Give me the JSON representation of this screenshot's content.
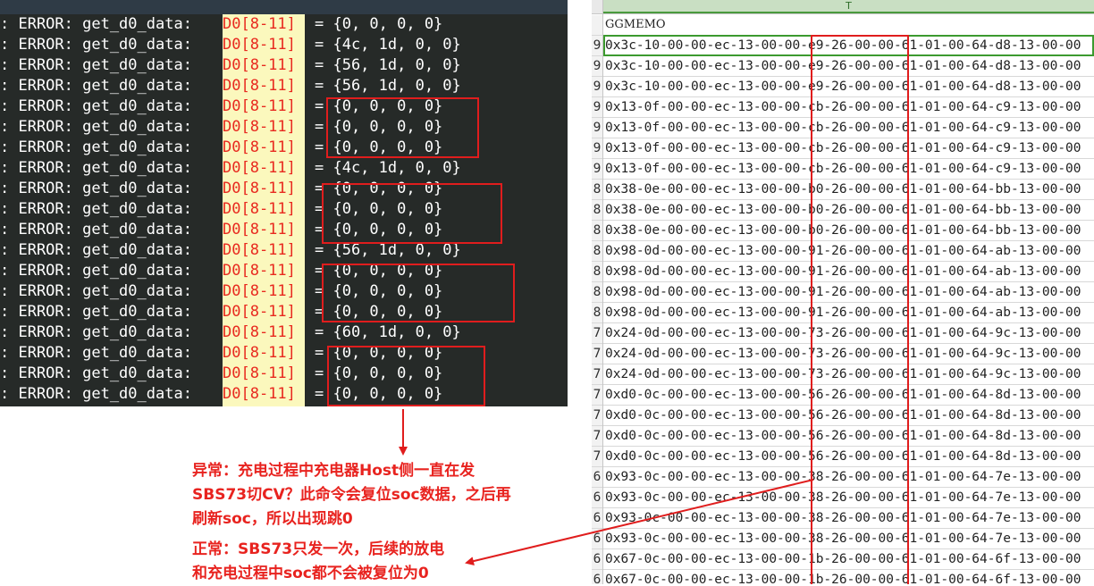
{
  "terminal": {
    "lines": [
      {
        "prefix": ": ERROR: get_d0_data:",
        "reg": "D0[8-11]",
        "value": "= {0, 0, 0, 0}"
      },
      {
        "prefix": ": ERROR: get_d0_data:",
        "reg": "D0[8-11]",
        "value": "= {4c, 1d, 0, 0}"
      },
      {
        "prefix": ": ERROR: get_d0_data:",
        "reg": "D0[8-11]",
        "value": "= {56, 1d, 0, 0}"
      },
      {
        "prefix": ": ERROR: get_d0_data:",
        "reg": "D0[8-11]",
        "value": "= {56, 1d, 0, 0}"
      },
      {
        "prefix": ": ERROR: get_d0_data:",
        "reg": "D0[8-11]",
        "value": "= {0, 0, 0, 0}"
      },
      {
        "prefix": ": ERROR: get_d0_data:",
        "reg": "D0[8-11]",
        "value": "= {0, 0, 0, 0}"
      },
      {
        "prefix": ": ERROR: get_d0_data:",
        "reg": "D0[8-11]",
        "value": "= {0, 0, 0, 0}"
      },
      {
        "prefix": ": ERROR: get_d0_data:",
        "reg": "D0[8-11]",
        "value": "= {4c, 1d, 0, 0}"
      },
      {
        "prefix": ": ERROR: get_d0_data:",
        "reg": "D0[8-11]",
        "value": "= {0, 0, 0, 0}"
      },
      {
        "prefix": ": ERROR: get_d0_data:",
        "reg": "D0[8-11]",
        "value": "= {0, 0, 0, 0}"
      },
      {
        "prefix": ": ERROR: get_d0_data:",
        "reg": "D0[8-11]",
        "value": "= {0, 0, 0, 0}"
      },
      {
        "prefix": ": ERROR: get_d0_data:",
        "reg": "D0[8-11]",
        "value": "= {56, 1d, 0, 0}"
      },
      {
        "prefix": ": ERROR: get_d0_data:",
        "reg": "D0[8-11]",
        "value": "= {0, 0, 0, 0}"
      },
      {
        "prefix": ": ERROR: get_d0_data:",
        "reg": "D0[8-11]",
        "value": "= {0, 0, 0, 0}"
      },
      {
        "prefix": ": ERROR: get_d0_data:",
        "reg": "D0[8-11]",
        "value": "= {0, 0, 0, 0}"
      },
      {
        "prefix": ": ERROR: get_d0_data:",
        "reg": "D0[8-11]",
        "value": "= {60, 1d, 0, 0}"
      },
      {
        "prefix": ": ERROR: get_d0_data:",
        "reg": "D0[8-11]",
        "value": "= {0, 0, 0, 0}"
      },
      {
        "prefix": ": ERROR: get_d0_data:",
        "reg": "D0[8-11]",
        "value": "= {0, 0, 0, 0}"
      },
      {
        "prefix": ": ERROR: get_d0_data:",
        "reg": "D0[8-11]",
        "value": "= {0, 0, 0, 0}"
      }
    ]
  },
  "sheet": {
    "column_letter": "T",
    "header": "GGMEMO",
    "rows": [
      {
        "rn": "9",
        "text": "0x3c-10-00-00-ec-13-00-00-e9-26-00-00-61-01-00-64-d8-13-00-00"
      },
      {
        "rn": "9",
        "text": "0x3c-10-00-00-ec-13-00-00-e9-26-00-00-61-01-00-64-d8-13-00-00"
      },
      {
        "rn": "9",
        "text": "0x3c-10-00-00-ec-13-00-00-e9-26-00-00-61-01-00-64-d8-13-00-00"
      },
      {
        "rn": "9",
        "text": "0x13-0f-00-00-ec-13-00-00-cb-26-00-00-61-01-00-64-c9-13-00-00"
      },
      {
        "rn": "9",
        "text": "0x13-0f-00-00-ec-13-00-00-cb-26-00-00-61-01-00-64-c9-13-00-00"
      },
      {
        "rn": "9",
        "text": "0x13-0f-00-00-ec-13-00-00-cb-26-00-00-61-01-00-64-c9-13-00-00"
      },
      {
        "rn": "9",
        "text": "0x13-0f-00-00-ec-13-00-00-cb-26-00-00-61-01-00-64-c9-13-00-00"
      },
      {
        "rn": "8",
        "text": "0x38-0e-00-00-ec-13-00-00-b0-26-00-00-61-01-00-64-bb-13-00-00"
      },
      {
        "rn": "8",
        "text": "0x38-0e-00-00-ec-13-00-00-b0-26-00-00-61-01-00-64-bb-13-00-00"
      },
      {
        "rn": "8",
        "text": "0x38-0e-00-00-ec-13-00-00-b0-26-00-00-61-01-00-64-bb-13-00-00"
      },
      {
        "rn": "8",
        "text": "0x98-0d-00-00-ec-13-00-00-91-26-00-00-61-01-00-64-ab-13-00-00"
      },
      {
        "rn": "8",
        "text": "0x98-0d-00-00-ec-13-00-00-91-26-00-00-61-01-00-64-ab-13-00-00"
      },
      {
        "rn": "8",
        "text": "0x98-0d-00-00-ec-13-00-00-91-26-00-00-61-01-00-64-ab-13-00-00"
      },
      {
        "rn": "8",
        "text": "0x98-0d-00-00-ec-13-00-00-91-26-00-00-61-01-00-64-ab-13-00-00"
      },
      {
        "rn": "7",
        "text": "0x24-0d-00-00-ec-13-00-00-73-26-00-00-61-01-00-64-9c-13-00-00"
      },
      {
        "rn": "7",
        "text": "0x24-0d-00-00-ec-13-00-00-73-26-00-00-61-01-00-64-9c-13-00-00"
      },
      {
        "rn": "7",
        "text": "0x24-0d-00-00-ec-13-00-00-73-26-00-00-61-01-00-64-9c-13-00-00"
      },
      {
        "rn": "7",
        "text": "0xd0-0c-00-00-ec-13-00-00-56-26-00-00-61-01-00-64-8d-13-00-00"
      },
      {
        "rn": "7",
        "text": "0xd0-0c-00-00-ec-13-00-00-56-26-00-00-61-01-00-64-8d-13-00-00"
      },
      {
        "rn": "7",
        "text": "0xd0-0c-00-00-ec-13-00-00-56-26-00-00-61-01-00-64-8d-13-00-00"
      },
      {
        "rn": "7",
        "text": "0xd0-0c-00-00-ec-13-00-00-56-26-00-00-61-01-00-64-8d-13-00-00"
      },
      {
        "rn": "6",
        "text": "0x93-0c-00-00-ec-13-00-00-38-26-00-00-61-01-00-64-7e-13-00-00"
      },
      {
        "rn": "6",
        "text": "0x93-0c-00-00-ec-13-00-00-38-26-00-00-61-01-00-64-7e-13-00-00"
      },
      {
        "rn": "6",
        "text": "0x93-0c-00-00-ec-13-00-00-38-26-00-00-61-01-00-64-7e-13-00-00"
      },
      {
        "rn": "6",
        "text": "0x93-0c-00-00-ec-13-00-00-38-26-00-00-61-01-00-64-7e-13-00-00"
      },
      {
        "rn": "6",
        "text": "0x67-0c-00-00-ec-13-00-00-1b-26-00-00-61-01-00-64-6f-13-00-00"
      },
      {
        "rn": "6",
        "text": "0x67-0c-00-00-ec-13-00-00-1b-26-00-00-61-01-00-64-6f-13-00-00"
      }
    ]
  },
  "notes": {
    "abnormal": {
      "line1": "异常：充电过程中充电器Host侧一直在发",
      "line2": "SBS73切CV？此命令会复位soc数据，之后再",
      "line3": "刷新soc，所以出现跳0"
    },
    "normal": {
      "line1": "正常：SBS73只发一次，后续的放电",
      "line2": "和充电过程中soc都不会被复位为0"
    }
  },
  "colors": {
    "terminal_bg": "#262a28",
    "highlight": "#fbf8bd",
    "annotation_red": "#e01d1d",
    "selection_green": "#3c9a2f"
  }
}
